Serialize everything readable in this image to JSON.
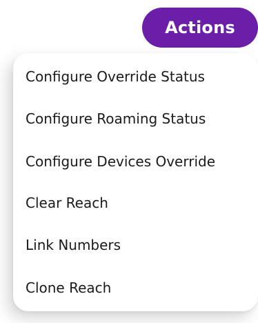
{
  "actions_button": {
    "label": "Actions",
    "color": "#6b1fa8"
  },
  "menu": {
    "items": [
      {
        "label": "Configure Override Status"
      },
      {
        "label": "Configure Roaming Status"
      },
      {
        "label": "Configure Devices Override"
      },
      {
        "label": "Clear Reach"
      },
      {
        "label": "Link Numbers"
      },
      {
        "label": "Clone Reach"
      }
    ]
  }
}
